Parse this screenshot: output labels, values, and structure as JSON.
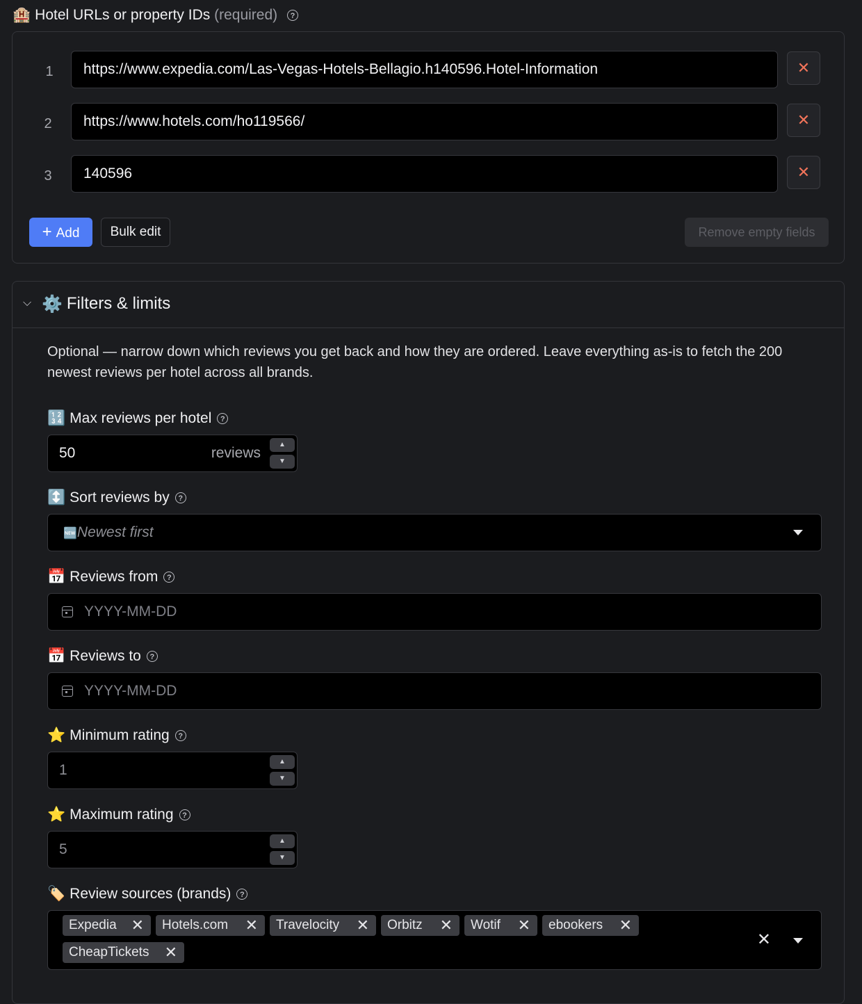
{
  "hotels": {
    "emoji": "🏨",
    "title": "Hotel URLs or property IDs",
    "required_label": "(required)",
    "help": "?",
    "rows": [
      {
        "index": "1",
        "value": "https://www.expedia.com/Las-Vegas-Hotels-Bellagio.h140596.Hotel-Information"
      },
      {
        "index": "2",
        "value": "https://www.hotels.com/ho119566/"
      },
      {
        "index": "3",
        "value": "140596"
      }
    ],
    "remove_icon": "✕",
    "add_label": "Add",
    "add_icon": "+",
    "bulk_edit_label": "Bulk edit",
    "remove_empty_label": "Remove empty fields"
  },
  "filters": {
    "emoji": "⚙️",
    "title": "Filters & limits",
    "description": "Optional — narrow down which reviews you get back and how they are ordered. Leave everything as-is to fetch the 200 newest reviews per hotel across all brands.",
    "max_reviews": {
      "emoji": "🔢",
      "label": "Max reviews per hotel",
      "value": "50",
      "unit": "reviews"
    },
    "sort": {
      "emoji": "↕️",
      "label": "Sort reviews by",
      "value_emoji": "🆕",
      "value": "Newest first"
    },
    "reviews_from": {
      "emoji": "📅",
      "label": "Reviews from",
      "placeholder": "YYYY-MM-DD"
    },
    "reviews_to": {
      "emoji": "📅",
      "label": "Reviews to",
      "placeholder": "YYYY-MM-DD"
    },
    "min_rating": {
      "emoji": "⭐",
      "label": "Minimum rating",
      "value": "1"
    },
    "max_rating": {
      "emoji": "⭐",
      "label": "Maximum rating",
      "value": "5"
    },
    "sources": {
      "emoji": "🏷️",
      "label": "Review sources (brands)",
      "tags": [
        "Expedia",
        "Hotels.com",
        "Travelocity",
        "Orbitz",
        "Wotif",
        "ebookers",
        "CheapTickets"
      ]
    }
  }
}
